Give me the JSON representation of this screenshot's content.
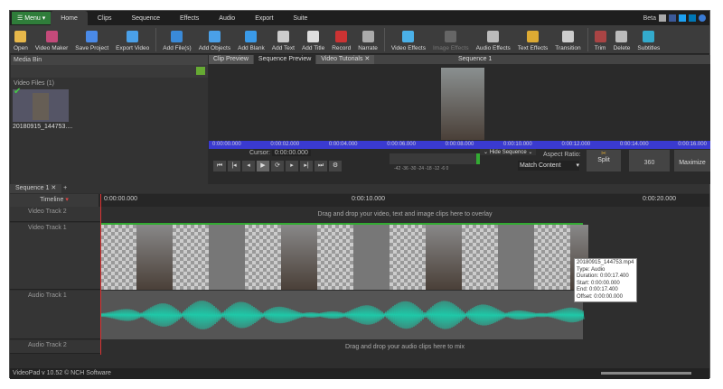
{
  "app": {
    "menu": "Menu",
    "tabs": [
      "Home",
      "Clips",
      "Sequence",
      "Effects",
      "Audio",
      "Export",
      "Suite"
    ],
    "beta": "Beta"
  },
  "toolbar": [
    "Open",
    "Video Maker",
    "Save Project",
    "Export Video",
    "Add File(s)",
    "Add Objects",
    "Add Blank",
    "Add Text",
    "Add Title",
    "Record",
    "Narrate",
    "Video Effects",
    "Image Effects",
    "Audio Effects",
    "Text Effects",
    "Transition",
    "Trim",
    "Delete",
    "Subtitles"
  ],
  "colors": {
    "accent": "#2f7d3a",
    "ruler": "#3a3ad0",
    "waveform": "#1fc8a8"
  },
  "bin": {
    "title": "Media Bin",
    "folder": "Video Files (1)",
    "file": "20180915_144753...."
  },
  "preview": {
    "tabs": [
      "Clip Preview",
      "Sequence Preview",
      "Video Tutorials"
    ],
    "title": "Sequence 1",
    "ruler": [
      "0:00:00.000",
      "0:00:02.000",
      "0:00:04.000",
      "0:00:06.000",
      "0:00:08.000",
      "0:00:10.000",
      "0:00:12.000",
      "0:00:14.000",
      "0:00:16.000"
    ],
    "hide": "Hide Sequence",
    "cursor_label": "Cursor:",
    "cursor": "0:00:00.000",
    "meter": "-42 -36 -30 -24 -18 -12 -6 0",
    "aspect_label": "Aspect Ratio:",
    "aspect": "Match Content",
    "split": "Split",
    "r360": "360",
    "maximize": "Maximize"
  },
  "sequence": {
    "tab": "Sequence 1",
    "timeline": "Timeline",
    "ticks": [
      "0:00:00.000",
      "0:00:10.000",
      "0:00:20.000"
    ],
    "tracks": {
      "v2": "Video Track 2",
      "v1": "Video Track 1",
      "a1": "Audio Track 1",
      "a2": "Audio Track 2"
    },
    "drop_video": "Drag and drop your video, text and image clips here to overlay",
    "drop_audio": "Drag and drop your audio clips here to mix"
  },
  "tooltip": [
    "20180915_144753.mp4",
    "Type: Audio",
    "Duration: 0:00:17.400",
    "Start: 0:00:00.000",
    "End: 0:00:17.400",
    "Offset: 0:00:00.000"
  ],
  "status": "VideoPad v 10.52 © NCH Software"
}
